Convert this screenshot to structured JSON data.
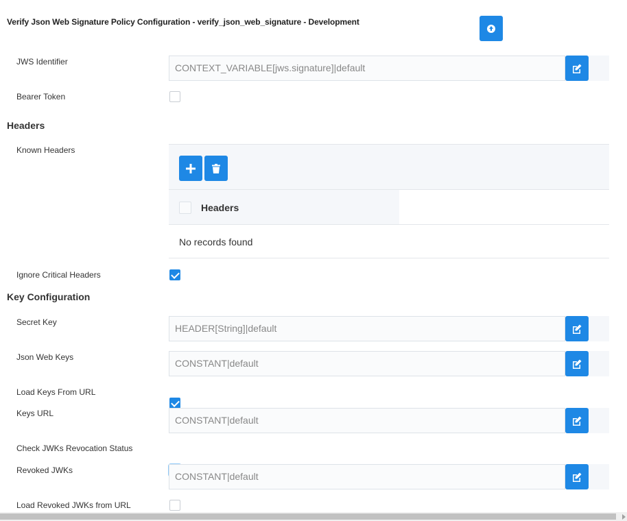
{
  "title": "Verify Json Web Signature Policy Configuration - verify_json_web_signature - Development",
  "colors": {
    "accent": "#1e88e5",
    "panel": "#f5f7fa",
    "field_text": "#888888"
  },
  "fields": {
    "jws_identifier": {
      "label": "JWS Identifier",
      "value": "CONTEXT_VARIABLE[jws.signature]|default"
    },
    "bearer_token": {
      "label": "Bearer Token",
      "checked": false
    },
    "secret_key": {
      "label": "Secret Key",
      "value": "HEADER[String]|default"
    },
    "json_web_keys": {
      "label": "Json Web Keys",
      "value": "CONSTANT|default"
    },
    "load_keys_from_url": {
      "label": "Load Keys From URL",
      "checked": true
    },
    "keys_url": {
      "label": "Keys URL",
      "value": "CONSTANT|default"
    },
    "check_jwks_revocation": {
      "label": "Check JWKs Revocation Status",
      "checked": true
    },
    "revoked_jwks": {
      "label": "Revoked JWKs",
      "value": "CONSTANT|default"
    },
    "load_revoked_jwks_from_url": {
      "label": "Load Revoked JWKs from URL",
      "checked": false
    },
    "ignore_critical_headers": {
      "label": "Ignore Critical Headers",
      "checked": true
    }
  },
  "sections": {
    "headers": "Headers",
    "key_configuration": "Key Configuration"
  },
  "known_headers": {
    "label": "Known Headers",
    "column": "Headers",
    "empty_message": "No records found",
    "add_icon": "plus-icon",
    "delete_icon": "trash-icon"
  },
  "icons": {
    "upload": "arrow-circle-up-icon",
    "edit": "edit-icon"
  }
}
